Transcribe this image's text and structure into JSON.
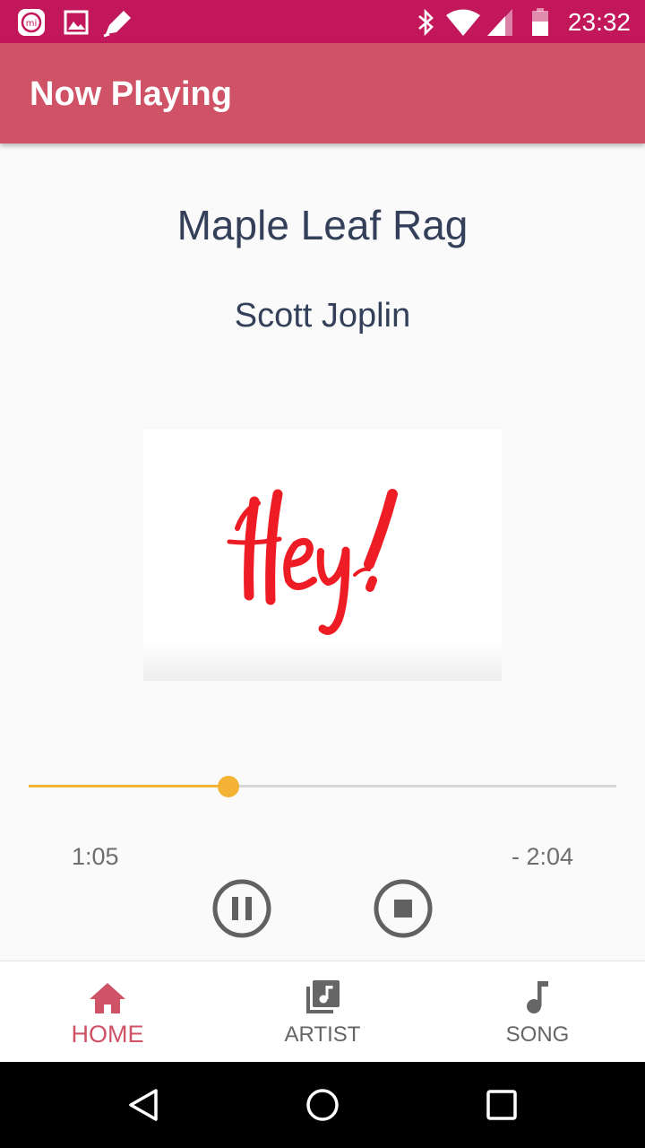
{
  "status_bar": {
    "time": "23:32",
    "left_icons": [
      "mi-app-icon",
      "image-icon",
      "edit-icon"
    ],
    "right_icons": [
      "bluetooth-icon",
      "wifi-icon",
      "signal-icon",
      "battery-icon"
    ],
    "color": "#c2185b"
  },
  "app_bar": {
    "title": "Now Playing",
    "color": "#cf5266"
  },
  "now_playing": {
    "song_title": "Maple Leaf Rag",
    "artist": "Scott Joplin",
    "album_art_text": "Hey!",
    "elapsed": "1:05",
    "remaining": "- 2:04",
    "progress": 0.34,
    "accent_color": "#f5b335"
  },
  "controls": {
    "pause_icon": "pause-circle-icon",
    "stop_icon": "stop-circle-icon"
  },
  "bottom_nav": {
    "items": [
      {
        "label": "HOME",
        "icon": "home-icon",
        "active": true
      },
      {
        "label": "ARTIST",
        "icon": "library-music-icon",
        "active": false
      },
      {
        "label": "SONG",
        "icon": "music-note-icon",
        "active": false
      }
    ],
    "active_color": "#cf5266"
  },
  "system_nav": {
    "buttons": [
      "back-icon",
      "home-circle-icon",
      "recents-icon"
    ]
  }
}
